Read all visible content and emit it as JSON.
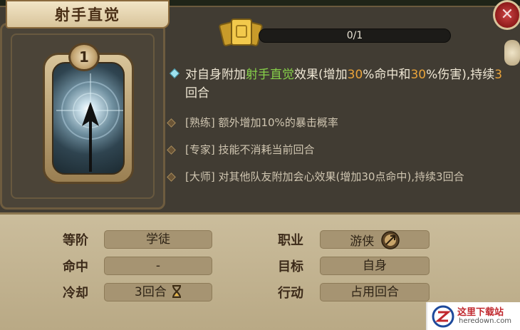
{
  "skill": {
    "title": "射手直觉",
    "rank": "1",
    "progress_text": "0/1",
    "progress_fraction": 0.0
  },
  "description": {
    "parts": [
      {
        "text": "对自身附加",
        "style": "normal"
      },
      {
        "text": "射手直觉",
        "style": "green"
      },
      {
        "text": "效果(增加",
        "style": "normal"
      },
      {
        "text": "30",
        "style": "orange"
      },
      {
        "text": "%命中和",
        "style": "normal"
      },
      {
        "text": "30",
        "style": "orange"
      },
      {
        "text": "%伤害),持续",
        "style": "normal"
      },
      {
        "text": "3",
        "style": "orange"
      },
      {
        "text": "回合",
        "style": "normal"
      }
    ],
    "sub_items": [
      "[熟练] 额外增加10%的暴击概率",
      "[专家] 技能不消耗当前回合",
      "[大师] 对其他队友附加会心效果(增加30点命中),持续3回合"
    ]
  },
  "stats": {
    "tier_label": "等阶",
    "tier_value": "学徒",
    "hit_label": "命中",
    "hit_value": "-",
    "cooldown_label": "冷却",
    "cooldown_value": "3回合",
    "job_label": "职业",
    "job_value": "游侠",
    "target_label": "目标",
    "target_value": "自身",
    "action_label": "行动",
    "action_value": "占用回合"
  },
  "watermark": {
    "cn": "这里下载站",
    "en": "heredown.com"
  },
  "colors": {
    "green": "#87d14a",
    "orange": "#e9a33a"
  }
}
